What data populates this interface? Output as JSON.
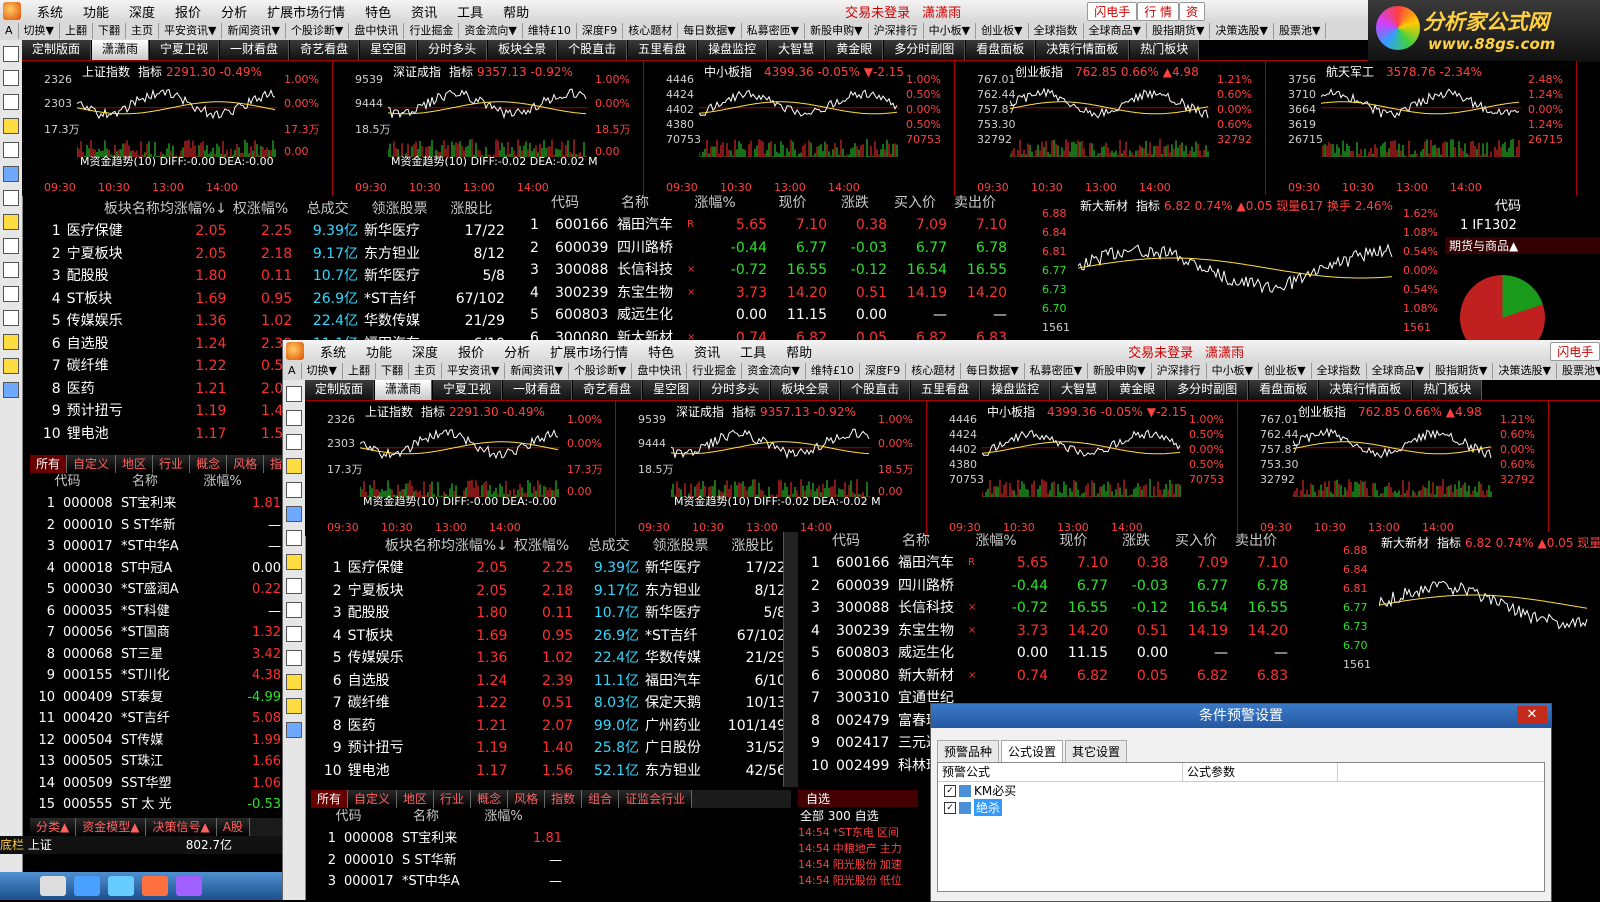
{
  "colors": {
    "rise": "#ff3030",
    "fall": "#2ee02e",
    "bg": "#000000",
    "grid": "#aa0000"
  },
  "menu": {
    "items": [
      "系统",
      "功能",
      "深度",
      "报价",
      "分析",
      "扩展市场行情",
      "特色",
      "资讯",
      "工具",
      "帮助"
    ],
    "login": "交易未登录",
    "user": "潇潇雨",
    "flash": "闪电手",
    "quote": "行 情",
    "res": "资"
  },
  "toolbar": [
    "A",
    "切换▼",
    "上翻",
    "下翻",
    "主页",
    "平安资讯▼",
    "新闻资讯▼",
    "个股诊断▼",
    "盘中快讯",
    "行业掘金",
    "资金流向▼",
    "维特£10",
    "深度F9",
    "核心题材",
    "每日数据▼",
    "私募密匝▼",
    "新股申购▼",
    "沪深排行",
    "中小板▼",
    "创业板▼",
    "全球指数",
    "全球商品▼",
    "股指期货▼",
    "决策选股▼",
    "股票池▼"
  ],
  "tabs": [
    "定制版面",
    "潇潇雨",
    "宁夏卫视",
    "一财看盘",
    "奇艺看盘",
    "星空图",
    "分时多头",
    "板块全景",
    "个股直击",
    "五里看盘",
    "操盘监控",
    "大智慧",
    "黄金眼",
    "多分时副图",
    "看盘面板",
    "决策行情面板",
    "热门板块"
  ],
  "logo": {
    "line1": "分析家公式网",
    "line2": "www.88gs.com"
  },
  "panels": [
    {
      "name": "上证指数",
      "label": "指标",
      "value": "2291.30 -0.49%",
      "y": [
        "2326",
        "2303",
        "17.3万"
      ],
      "yr": [
        "1.00%",
        "0.00%",
        "17.3万",
        "0.00"
      ],
      "macd": "M资金趋势(10) DIFF:-0.00 DEA:-0.00"
    },
    {
      "name": "深证成指",
      "label": "指标",
      "value": "9357.13 -0.92%",
      "y": [
        "9539",
        "9444",
        "18.5万"
      ],
      "yr": [
        "1.00%",
        "0.00%",
        "18.5万",
        "0.00"
      ],
      "macd": "M资金趋势(10) DIFF:-0.02 DEA:-0.02 M"
    },
    {
      "name": "中小板指",
      "label": "",
      "value": "4399.36 -0.05% ▼-2.15",
      "y": [
        "4446",
        "4424",
        "4402",
        "4380",
        "70753"
      ],
      "yr": [
        "1.00%",
        "0.50%",
        "0.00%",
        "0.50%",
        "70753"
      ],
      "macd": ""
    },
    {
      "name": "创业板指",
      "label": "",
      "value": "762.85 0.66% ▲4.98",
      "y": [
        "767.01",
        "762.44",
        "757.87",
        "753.30",
        "32792"
      ],
      "yr": [
        "1.21%",
        "0.60%",
        "0.00%",
        "0.60%",
        "32792"
      ],
      "macd": ""
    },
    {
      "name": "航天军工",
      "label": "",
      "value": "3578.76 -2.34%",
      "y": [
        "3756",
        "3710",
        "3664",
        "3619",
        "26715"
      ],
      "yr": [
        "2.48%",
        "1.24%",
        "0.00%",
        "1.24%",
        "26715"
      ],
      "macd": ""
    }
  ],
  "times": [
    "09:30",
    "10:30",
    "13:00",
    "14:00"
  ],
  "sectors": {
    "headers": [
      "板块名称",
      "均涨幅%↓",
      "权涨幅%",
      "总成交",
      "领涨股票",
      "涨股比"
    ],
    "rows": [
      [
        "1",
        "医疗保健",
        "2.05",
        "2.25",
        "9.39亿",
        "新华医疗",
        "17/22"
      ],
      [
        "2",
        "宁夏板块",
        "2.05",
        "2.18",
        "9.17亿",
        "东方钽业",
        "8/12"
      ],
      [
        "3",
        "配股股",
        "1.80",
        "0.11",
        "10.7亿",
        "新华医疗",
        "5/8"
      ],
      [
        "4",
        "ST板块",
        "1.69",
        "0.95",
        "26.9亿",
        "*ST吉纤",
        "67/102"
      ],
      [
        "5",
        "传媒娱乐",
        "1.36",
        "1.02",
        "22.4亿",
        "华数传媒",
        "21/29"
      ],
      [
        "6",
        "自选股",
        "1.24",
        "2.39",
        "11.1亿",
        "福田汽车",
        "6/10"
      ],
      [
        "7",
        "碳纤维",
        "1.22",
        "0.51",
        "8.03亿",
        "保定天鹅",
        "10/13"
      ],
      [
        "8",
        "医药",
        "1.21",
        "2.07",
        "99.0亿",
        "广州药业",
        "101/149"
      ],
      [
        "9",
        "预计扭亏",
        "1.19",
        "1.40",
        "25.8亿",
        "广日股份",
        "31/52"
      ],
      [
        "10",
        "锂电池",
        "1.17",
        "1.56",
        "52.1亿",
        "东方钽业",
        "42/56"
      ]
    ]
  },
  "stocks": {
    "headers": [
      "代码",
      "名称",
      "涨幅%",
      "现价",
      "涨跌",
      "买入价",
      "卖出价"
    ],
    "rows": [
      [
        "1",
        "600166",
        "福田汽车",
        "R",
        "5.65",
        "7.10",
        "0.38",
        "7.09",
        "7.10"
      ],
      [
        "2",
        "600039",
        "四川路桥",
        "",
        "-0.44",
        "6.77",
        "-0.03",
        "6.77",
        "6.78"
      ],
      [
        "3",
        "300088",
        "长信科技",
        "×",
        "-0.72",
        "16.55",
        "-0.12",
        "16.54",
        "16.55"
      ],
      [
        "4",
        "300239",
        "东宝生物",
        "×",
        "3.73",
        "14.20",
        "0.51",
        "14.19",
        "14.20"
      ],
      [
        "5",
        "600803",
        "威远生化",
        "",
        "0.00",
        "11.15",
        "0.00",
        "—",
        "—"
      ],
      [
        "6",
        "300080",
        "新大新材",
        "×",
        "0.74",
        "6.82",
        "0.05",
        "6.82",
        "6.83"
      ]
    ]
  },
  "st": {
    "headers": [
      "代码",
      "名称",
      "涨幅%"
    ],
    "rows": [
      [
        "1",
        "000008",
        "ST宝利来",
        "1.81"
      ],
      [
        "2",
        "000010",
        "S ST华新",
        "—"
      ],
      [
        "3",
        "000017",
        "*ST中华A",
        "—"
      ],
      [
        "4",
        "000018",
        "ST中冠A",
        "0.00"
      ],
      [
        "5",
        "000030",
        "*ST盛润A",
        "0.22"
      ],
      [
        "6",
        "000035",
        "*ST科健",
        "—"
      ],
      [
        "7",
        "000056",
        "*ST国商",
        "1.32"
      ],
      [
        "8",
        "000068",
        "ST三星",
        "3.42"
      ],
      [
        "9",
        "000155",
        "*ST川化",
        "4.38"
      ],
      [
        "10",
        "000409",
        "ST泰复",
        "-4.99"
      ],
      [
        "11",
        "000420",
        "*ST吉纤",
        "5.08"
      ],
      [
        "12",
        "000504",
        "ST传媒",
        "1.99"
      ],
      [
        "13",
        "000505",
        "ST珠江",
        "1.66"
      ],
      [
        "14",
        "000509",
        "SST华塑",
        "1.06"
      ],
      [
        "15",
        "000555",
        "ST 太 光",
        "-0.53"
      ]
    ]
  },
  "lefttabs": [
    "所有",
    "自定义",
    "地区",
    "行业",
    "概念",
    "风格",
    "指"
  ],
  "lefttabs2": [
    "所有",
    "自定义",
    "地区",
    "行业",
    "概念",
    "风格",
    "指数",
    "组合",
    "证监会行业"
  ],
  "bottom_left": [
    "分类▲",
    "资金模型▲",
    "决策信号▲",
    "A股"
  ],
  "mini": {
    "name": "新大新材",
    "label": "指标",
    "value": "6.82 0.74% ▲0.05 现量617 换手 2.46%",
    "y": [
      "6.88",
      "6.84",
      "6.81",
      "6.77",
      "6.73",
      "6.70",
      "1561"
    ],
    "yr": [
      "1.62%",
      "1.08%",
      "0.54%",
      "0.00%",
      "0.54%",
      "1.08%",
      "1561"
    ]
  },
  "futures": {
    "h": "代码",
    "row": "1   IF1302",
    "title": "期货与商品▲"
  },
  "status": {
    "label": "底栏",
    "index": "上证",
    "value": "802.7亿"
  },
  "zixuan": {
    "label": "自选",
    "all": "全部",
    "count": "300",
    "self": "自选",
    "ticks": [
      [
        "14:54",
        "*ST东电",
        "区间"
      ],
      [
        "14:54",
        "中粮地产",
        "主力"
      ],
      [
        "14:54",
        "阳光股份",
        "加速"
      ],
      [
        "14:54",
        "阳光股份",
        "低位"
      ]
    ]
  },
  "dialog": {
    "title": "条件预警设置",
    "close": "✕",
    "tabs": [
      "预警品种",
      "公式设置",
      "其它设置"
    ],
    "cols": [
      "预警公式",
      "公式参数"
    ],
    "items": [
      "KM必买",
      "绝杀"
    ]
  },
  "stocks2_extra": [
    [
      "7",
      "300310",
      "宜通世纪"
    ],
    [
      "8",
      "002479",
      "富春环保"
    ],
    [
      "9",
      "002417",
      "三元达"
    ],
    [
      "10",
      "002499",
      "科林环保"
    ]
  ]
}
